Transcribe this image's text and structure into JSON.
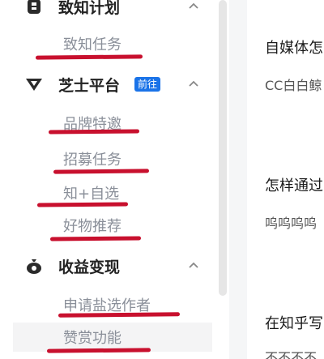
{
  "sidebar": {
    "sections": [
      {
        "title": "致知计划",
        "icon": "seal-icon",
        "items": [
          {
            "label": "致知任务"
          }
        ]
      },
      {
        "title": "芝士平台",
        "icon": "zhishi-logo-icon",
        "badge": "前往",
        "items": [
          {
            "label": "品牌特邀"
          },
          {
            "label": "招募任务"
          },
          {
            "label": "知+自选"
          },
          {
            "label": "好物推荐"
          }
        ]
      },
      {
        "title": "收益变现",
        "icon": "money-bag-icon",
        "items": [
          {
            "label": "申请盐选作者"
          },
          {
            "label": "赞赏功能"
          }
        ]
      }
    ]
  },
  "main": {
    "rows": [
      {
        "title": "自媒体怎",
        "desc": "CC白白鲸"
      },
      {
        "title": "怎样通过",
        "desc": "呜呜呜呜"
      },
      {
        "title": "在知乎写",
        "desc": "不不不不"
      }
    ]
  },
  "colors": {
    "accent": "#1a73e8",
    "annotation": "#c8102e"
  }
}
